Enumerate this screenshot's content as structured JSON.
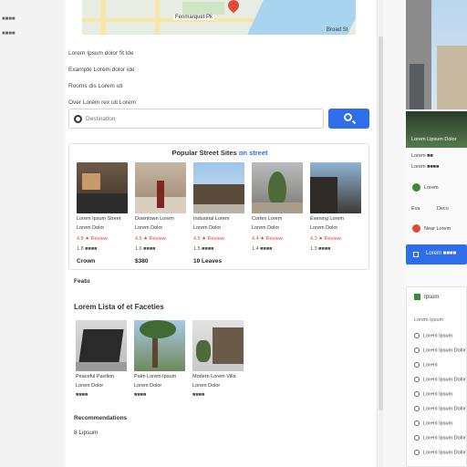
{
  "left_gutter": {
    "items": [
      "■■■■",
      "■■■■"
    ]
  },
  "map": {
    "label1": "Fenmarquet Pk",
    "label2": "Broad St"
  },
  "info": {
    "lines": [
      "Lorem Ipsum dolor fit ide",
      "Exampte Lorem dolor ide",
      "Rooms dis Lorem uti",
      "Over Lorem rex uti Lorem"
    ]
  },
  "search": {
    "placeholder": "Destination",
    "button_icon": "search-icon"
  },
  "listings": {
    "title_prefix": "Popular Street Sites",
    "title_link": "on street",
    "items": [
      {
        "title": "Lorem Ipsum Street",
        "sub": "Lorem Dolor",
        "rating": "4.8 ★ Review",
        "meta": "1.8 ■■■■",
        "price": "Crown"
      },
      {
        "title": "Downtown Lorem",
        "sub": "Lorem Dolor",
        "rating": "4.6 ★ Review",
        "meta": "1.6 ■■■■",
        "price": "$380"
      },
      {
        "title": "Industrial Lorem",
        "sub": "Lorem Dolor",
        "rating": "4.5 ★ Review",
        "meta": "1.5 ■■■■",
        "price": "10 Leaves"
      },
      {
        "title": "Cortex Lorem",
        "sub": "Lorem Dolor",
        "rating": "4.4 ★ Review",
        "meta": "1.4 ■■■■",
        "price": "—"
      },
      {
        "title": "Evening Lorem",
        "sub": "Lorem Dolor",
        "rating": "4.3 ★ Review",
        "meta": "1.3 ■■■■",
        "price": "—"
      }
    ]
  },
  "section2": {
    "small": "Featu",
    "heading": "Lorem Lista of et Faceties",
    "items": [
      {
        "title": "Peaceful Pavilion",
        "sub": "Lorem Dolor",
        "meta": "■■■■"
      },
      {
        "title": "Palm Lorem Ipsum",
        "sub": "Lorem Dolor",
        "meta": "■■■■"
      },
      {
        "title": "Modern Lorem Villa",
        "sub": "Lorem Dolor",
        "meta": "■■■■"
      }
    ],
    "sub": "Recommendations",
    "foot": "8 Lipsum"
  },
  "right": {
    "thumb_label": "Lorem Lipsum Dolor",
    "rows": [
      "Lorem ■■",
      "Lorem ■■■■"
    ],
    "tiles": [
      "Lorem",
      "Eva",
      "Deco"
    ],
    "badge": "Near Lorem",
    "button_label": "Lorem ■■■■",
    "panel_header": "Ipsum",
    "panel_sub": "Lorem Ipsum",
    "options": [
      "Lorem Ipsum",
      "Lorem Ipsum Dolor",
      "Lorem",
      "Lorem Ipsum Dolor",
      "Lorem Ipsum",
      "Lorem Ipsum Dolor",
      "Lorem Ipsum",
      "Lorem Ipsum Dolor",
      "Lorem Ipsum Dolor",
      "Lorem Ipsum"
    ]
  },
  "colors": {
    "accent": "#2f6ee8",
    "danger": "#e04a3a",
    "success": "#3a8a3a"
  }
}
